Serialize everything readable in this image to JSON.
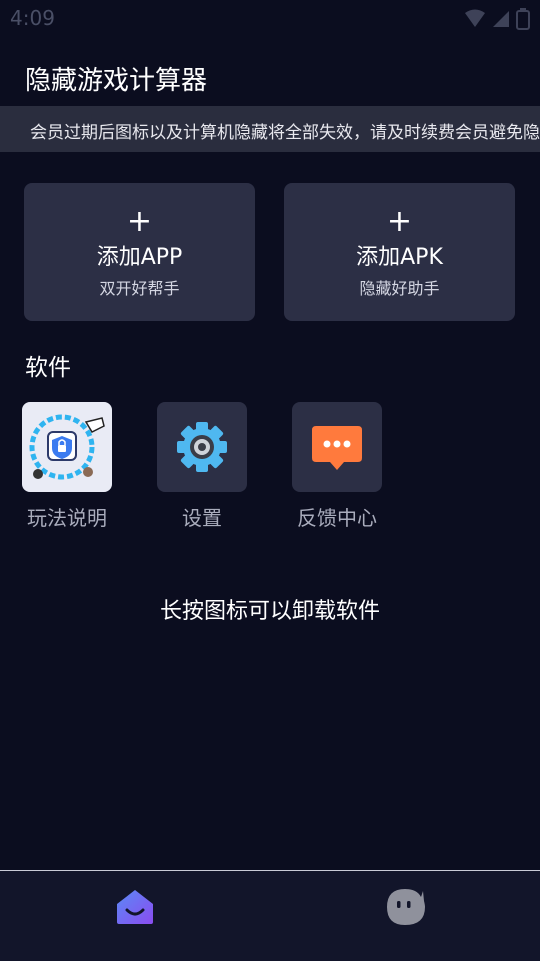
{
  "status_bar": {
    "time": "4:09"
  },
  "header": {
    "title": "隐藏游戏计算器"
  },
  "notice": {
    "text": "会员过期后图标以及计算机隐藏将全部失效，请及时续费会员避免隐"
  },
  "actions": [
    {
      "plus": "+",
      "label": "添加APP",
      "sub": "双开好帮手"
    },
    {
      "plus": "+",
      "label": "添加APK",
      "sub": "隐藏好助手"
    }
  ],
  "section": {
    "title": "软件"
  },
  "apps": [
    {
      "label": "玩法说明",
      "icon": "tutorial-icon"
    },
    {
      "label": "设置",
      "icon": "gear-icon"
    },
    {
      "label": "反馈中心",
      "icon": "chat-bubble-icon"
    }
  ],
  "hint": "长按图标可以卸载软件",
  "bottom_nav": {
    "items": [
      {
        "icon": "home-icon",
        "active": true
      },
      {
        "icon": "profile-face-icon",
        "active": false
      }
    ]
  },
  "colors": {
    "background": "#0b0d1f",
    "card": "#2c2f45",
    "notice_bar": "#2a2d3e",
    "accent_purple": "#6b5cf0",
    "chat_orange": "#ff7a3d",
    "gear_blue": "#4fb8f0"
  }
}
